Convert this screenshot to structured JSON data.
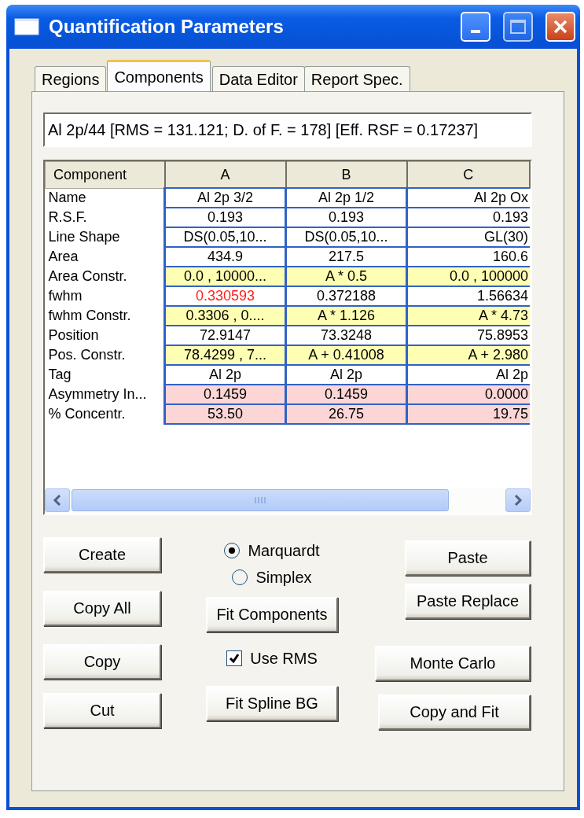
{
  "window": {
    "title": "Quantification Parameters"
  },
  "tabs": [
    {
      "label": "Regions",
      "selected": false
    },
    {
      "label": "Components",
      "selected": true
    },
    {
      "label": "Data Editor",
      "selected": false
    },
    {
      "label": "Report Spec.",
      "selected": false
    }
  ],
  "summary": {
    "value": "Al 2p/44 [RMS = 131.121; D. of F. = 178] [Eff. RSF = 0.17237]"
  },
  "table": {
    "columns": [
      "Component",
      "A",
      "B",
      "C"
    ],
    "rows": [
      {
        "kind": "value",
        "cells": [
          {
            "text": "Name",
            "warning": false
          },
          {
            "text": "Al 2p 3/2",
            "warning": false
          },
          {
            "text": "Al 2p 1/2",
            "warning": false
          },
          {
            "text": "Al 2p Ox",
            "warning": false
          }
        ]
      },
      {
        "kind": "value",
        "cells": [
          {
            "text": "R.S.F.",
            "warning": false
          },
          {
            "text": "0.193",
            "warning": false
          },
          {
            "text": "0.193",
            "warning": false
          },
          {
            "text": "0.193",
            "warning": false
          }
        ]
      },
      {
        "kind": "value",
        "cells": [
          {
            "text": "Line Shape",
            "warning": false
          },
          {
            "text": "DS(0.05,10...",
            "warning": false
          },
          {
            "text": "DS(0.05,10...",
            "warning": false
          },
          {
            "text": "GL(30)",
            "warning": false
          }
        ]
      },
      {
        "kind": "value",
        "cells": [
          {
            "text": "Area",
            "warning": false
          },
          {
            "text": "434.9",
            "warning": false
          },
          {
            "text": "217.5",
            "warning": false
          },
          {
            "text": "160.6",
            "warning": false
          }
        ]
      },
      {
        "kind": "constraint",
        "cells": [
          {
            "text": "Area Constr.",
            "warning": false
          },
          {
            "text": "0.0 , 10000...",
            "warning": false
          },
          {
            "text": "A * 0.5",
            "warning": false
          },
          {
            "text": "0.0 , 100000",
            "warning": false
          }
        ]
      },
      {
        "kind": "value",
        "cells": [
          {
            "text": "fwhm",
            "warning": false
          },
          {
            "text": "0.330593",
            "warning": true
          },
          {
            "text": "0.372188",
            "warning": false
          },
          {
            "text": "1.56634",
            "warning": false
          }
        ]
      },
      {
        "kind": "constraint",
        "cells": [
          {
            "text": "fwhm Constr.",
            "warning": false
          },
          {
            "text": "0.3306 , 0....",
            "warning": false
          },
          {
            "text": "A * 1.126",
            "warning": false
          },
          {
            "text": "A * 4.73",
            "warning": false
          }
        ]
      },
      {
        "kind": "value",
        "cells": [
          {
            "text": "Position",
            "warning": false
          },
          {
            "text": "72.9147",
            "warning": false
          },
          {
            "text": "73.3248",
            "warning": false
          },
          {
            "text": "75.8953",
            "warning": false
          }
        ]
      },
      {
        "kind": "constraint",
        "cells": [
          {
            "text": "Pos. Constr.",
            "warning": false
          },
          {
            "text": "78.4299 , 7...",
            "warning": false
          },
          {
            "text": "A + 0.41008",
            "warning": false
          },
          {
            "text": "A + 2.980",
            "warning": false
          }
        ]
      },
      {
        "kind": "value",
        "cells": [
          {
            "text": "Tag",
            "warning": false
          },
          {
            "text": "Al 2p",
            "warning": false
          },
          {
            "text": "Al 2p",
            "warning": false
          },
          {
            "text": "Al 2p",
            "warning": false
          }
        ]
      },
      {
        "kind": "result",
        "cells": [
          {
            "text": "Asymmetry In...",
            "warning": false
          },
          {
            "text": "0.1459",
            "warning": false
          },
          {
            "text": "0.1459",
            "warning": false
          },
          {
            "text": "0.0000",
            "warning": false
          }
        ]
      },
      {
        "kind": "result",
        "cells": [
          {
            "text": "% Concentr.",
            "warning": false
          },
          {
            "text": "53.50",
            "warning": false
          },
          {
            "text": "26.75",
            "warning": false
          },
          {
            "text": "19.75",
            "warning": false
          }
        ]
      }
    ]
  },
  "left_buttons": [
    "Create",
    "Copy All",
    "Copy",
    "Cut"
  ],
  "fit_method": [
    {
      "label": "Marquardt",
      "selected": true
    },
    {
      "label": "Simplex",
      "selected": false
    }
  ],
  "fit_components_button": "Fit Components",
  "use_rms": {
    "label": "Use RMS",
    "checked": true
  },
  "fit_spline_button": "Fit Spline BG",
  "right_buttons": [
    "Paste",
    "Paste Replace",
    "Monte Carlo",
    "Copy and Fit"
  ]
}
